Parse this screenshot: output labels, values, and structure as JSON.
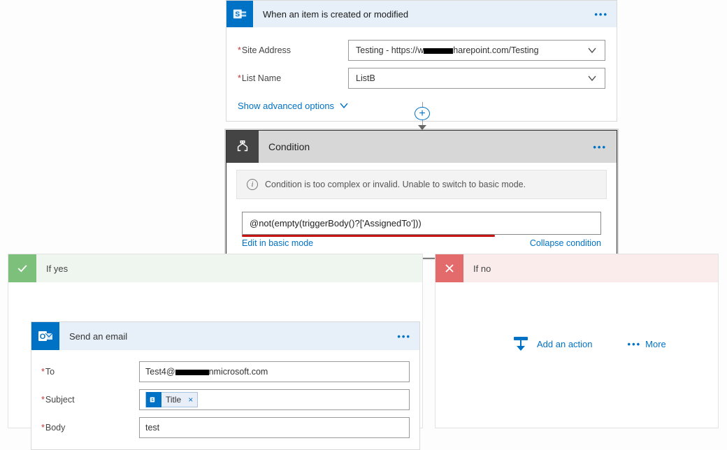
{
  "trigger": {
    "title": "When an item is created or modified",
    "fields": {
      "siteAddress": {
        "label": "Site Address",
        "prefix": "Testing - https://w",
        "suffix": "harepoint.com/Testing"
      },
      "listName": {
        "label": "List Name",
        "value": "ListB"
      }
    },
    "advancedLink": "Show advanced options"
  },
  "condition": {
    "title": "Condition",
    "warning": "Condition is too complex or invalid. Unable to switch to basic mode.",
    "expression": "@not(empty(triggerBody()?['AssignedTo']))",
    "editLink": "Edit in basic mode",
    "collapseLink": "Collapse condition"
  },
  "branches": {
    "yes": {
      "title": "If yes"
    },
    "no": {
      "title": "If no",
      "addAction": "Add an action",
      "more": "More"
    }
  },
  "email": {
    "title": "Send an email",
    "fields": {
      "to": {
        "label": "To",
        "prefix": "Test4@",
        "suffix": "nmicrosoft.com"
      },
      "subject": {
        "label": "Subject",
        "token": "Title"
      },
      "body": {
        "label": "Body",
        "value": "test"
      }
    }
  }
}
